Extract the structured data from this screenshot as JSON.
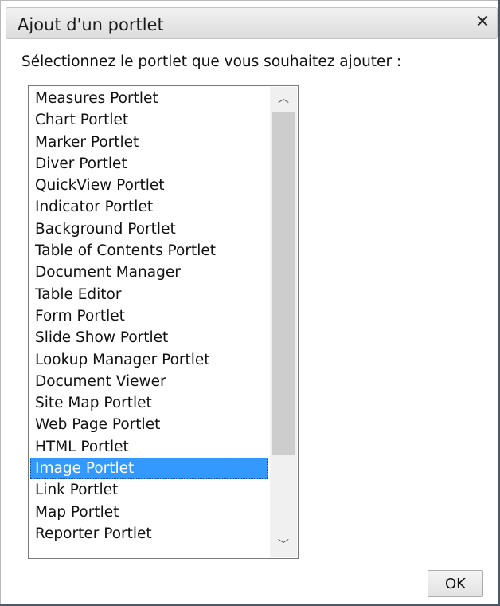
{
  "dialog": {
    "title": "Ajout d'un portlet",
    "close_glyph": "✕",
    "prompt": "Sélectionnez le portlet que vous souhaitez ajouter :",
    "ok_label": "OK"
  },
  "portlets": {
    "selected_index": 18,
    "items": [
      "Measures Portlet",
      "Chart Portlet",
      "Marker Portlet",
      "Diver Portlet",
      "QuickView Portlet",
      "Indicator Portlet",
      "Background Portlet",
      "Table of Contents Portlet",
      "Document Manager",
      "Table Editor",
      "Form Portlet",
      "Slide Show Portlet",
      "Lookup Manager Portlet",
      "Document Viewer",
      "Site Map Portlet",
      "Web Page Portlet",
      "HTML Portlet",
      "Image Portlet",
      "Link Portlet",
      "Map Portlet",
      "Reporter Portlet"
    ]
  },
  "scrollbar": {
    "up_icon": "chevron-up-icon",
    "down_icon": "chevron-down-icon",
    "up_glyph": "︿",
    "down_glyph": "﹀"
  }
}
